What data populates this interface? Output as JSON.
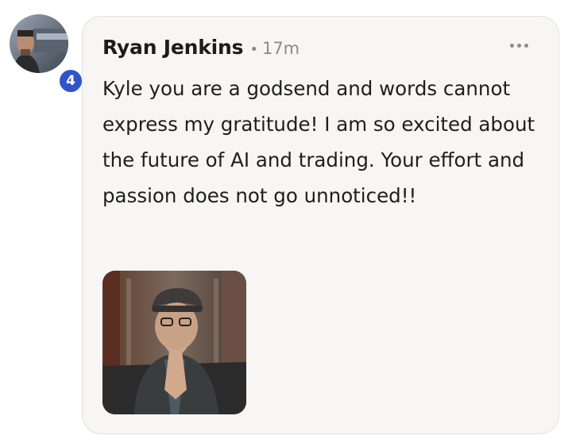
{
  "comment": {
    "author": "Ryan Jenkins",
    "separator": "•",
    "time": "17m",
    "level_badge": "4",
    "text": "Kyle you are a godsend and words cannot express my gratitude! I am so excited about the future of AI and trading. Your effort and passion does not go unnoticed!!",
    "attachment_type": "gif-image",
    "menu_icon": "more-horizontal-icon"
  },
  "colors": {
    "bubble_background": "#f7f6f4",
    "badge": "#2f53c9",
    "meta_text": "#8a8a8a"
  }
}
